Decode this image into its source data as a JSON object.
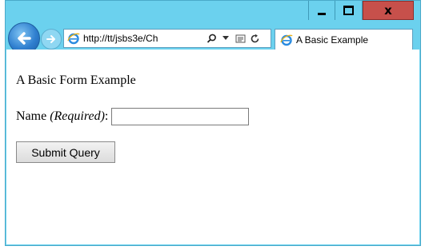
{
  "browser": {
    "address_url": "http://tt/jsbs3e/Ch",
    "tab_title": "A Basic Example",
    "accent_color": "#6bd1ee",
    "close_color": "#c7504b"
  },
  "icons": {
    "back": "arrow-left-icon",
    "forward": "arrow-right-icon",
    "ie": "ie-logo-icon",
    "search": "search-icon",
    "dropdown": "chevron-down-icon",
    "compat": "compatibility-view-icon",
    "refresh": "refresh-icon"
  },
  "page": {
    "heading": "A Basic Form Example",
    "name_label": "Name ",
    "required_label": "(Required)",
    "colon": ":",
    "name_value": "",
    "submit_label": "Submit Query"
  }
}
